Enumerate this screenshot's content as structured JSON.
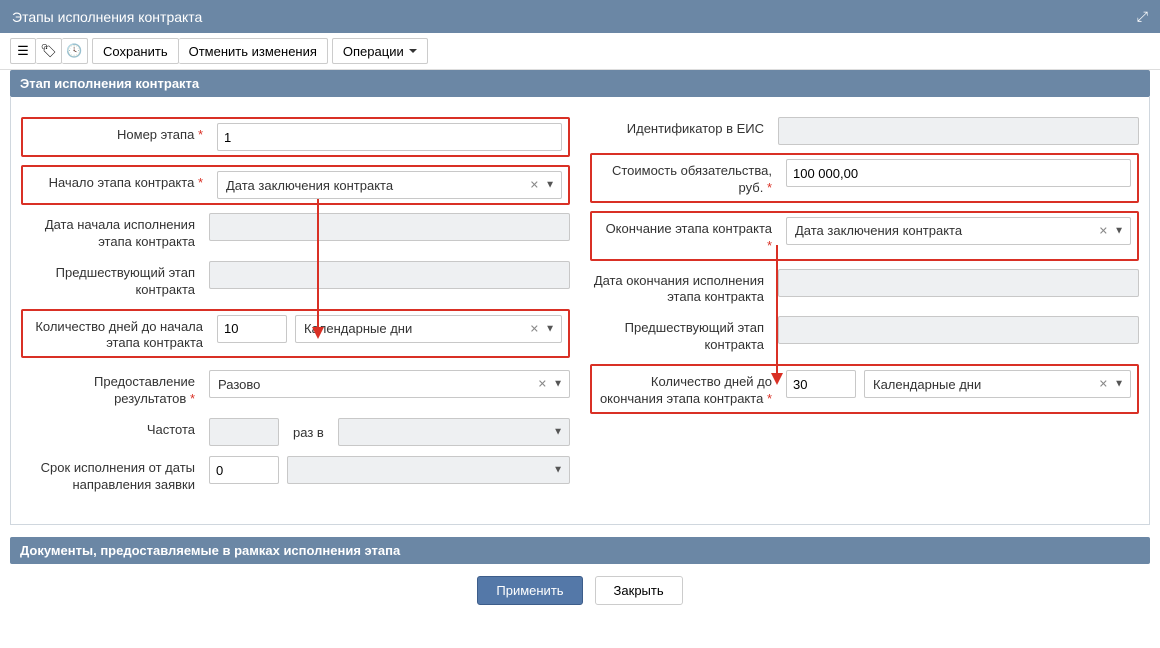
{
  "window": {
    "title": "Этапы исполнения контракта"
  },
  "toolbar": {
    "save": "Сохранить",
    "cancel": "Отменить изменения",
    "operations": "Операции"
  },
  "sections": {
    "stage": "Этап исполнения контракта",
    "documents": "Документы, предоставляемые в рамках исполнения этапа"
  },
  "left": {
    "stage_number": {
      "label": "Номер этапа",
      "value": "1"
    },
    "contract_start": {
      "label": "Начало этапа контракта",
      "value": "Дата заключения контракта"
    },
    "exec_start_date": {
      "label": "Дата начала исполнения этапа контракта"
    },
    "prev_stage": {
      "label": "Предшествующий этап контракта"
    },
    "days_to_start": {
      "label": "Количество дней до начала этапа контракта",
      "value": "10",
      "unit": "Календарные дни"
    },
    "results": {
      "label": "Предоставление результатов",
      "value": "Разово"
    },
    "frequency": {
      "label": "Частота",
      "middle": "раз в"
    },
    "exec_period": {
      "label": "Срок исполнения от даты направления заявки",
      "value": "0"
    }
  },
  "right": {
    "eis_id": {
      "label": "Идентификатор в ЕИС"
    },
    "cost": {
      "label": "Стоимость обязательства, руб.",
      "value": "100 000,00"
    },
    "contract_end": {
      "label": "Окончание этапа контракта",
      "value": "Дата заключения контракта"
    },
    "exec_end_date": {
      "label": "Дата окончания исполнения этапа контракта"
    },
    "prev_stage": {
      "label": "Предшествующий этап контракта"
    },
    "days_to_end": {
      "label": "Количество дней до окончания этапа контракта",
      "value": "30",
      "unit": "Календарные дни"
    }
  },
  "footer": {
    "apply": "Применить",
    "close": "Закрыть"
  }
}
